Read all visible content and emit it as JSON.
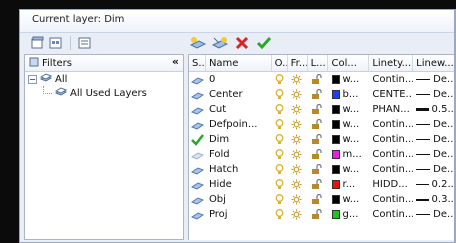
{
  "header": {
    "current_layer": "Current layer: Dim"
  },
  "filters": {
    "title": "Filters",
    "collapse_glyph": "«",
    "tree": [
      {
        "label": "All"
      },
      {
        "label": "All Used Layers"
      }
    ]
  },
  "grid": {
    "columns": [
      "S..",
      "Name",
      "O..",
      "Fr...",
      "L...",
      "Col...",
      "Linety...",
      "Linew..."
    ],
    "rows": [
      {
        "status": "sheet",
        "name": "0",
        "color_hex": "#000000",
        "color": "w...",
        "linetype": "Contin...",
        "lineweight": "De...",
        "lw_style": "thin"
      },
      {
        "status": "sheet",
        "name": "Center",
        "color_hex": "#1d3cff",
        "color": "b...",
        "linetype": "CENTE...",
        "lineweight": "De...",
        "lw_style": "thin"
      },
      {
        "status": "sheet",
        "name": "Cut",
        "color_hex": "#000000",
        "color": "w...",
        "linetype": "PHAN...",
        "lineweight": "0.5...",
        "lw_style": "thick"
      },
      {
        "status": "sheet",
        "name": "Defpoin...",
        "color_hex": "#000000",
        "color": "w...",
        "linetype": "Contin...",
        "lineweight": "De...",
        "lw_style": "thin"
      },
      {
        "status": "current",
        "name": "Dim",
        "color_hex": "#000000",
        "color": "w...",
        "linetype": "Contin...",
        "lineweight": "De...",
        "lw_style": "thin"
      },
      {
        "status": "sheet-faded",
        "name": "Fold",
        "color_hex": "#e61ee6",
        "color": "m...",
        "linetype": "Contin...",
        "lineweight": "De...",
        "lw_style": "thin"
      },
      {
        "status": "sheet",
        "name": "Hatch",
        "color_hex": "#000000",
        "color": "w...",
        "linetype": "Contin...",
        "lineweight": "De...",
        "lw_style": "thin"
      },
      {
        "status": "sheet",
        "name": "Hide",
        "color_hex": "#e81010",
        "color": "r...",
        "linetype": "HIDD...",
        "lineweight": "0.2...",
        "lw_style": "thin"
      },
      {
        "status": "sheet",
        "name": "Obj",
        "color_hex": "#000000",
        "color": "w...",
        "linetype": "Contin...",
        "lineweight": "0.3...",
        "lw_style": "medium"
      },
      {
        "status": "sheet",
        "name": "Proj",
        "color_hex": "#22c222",
        "color": "g...",
        "linetype": "Contin...",
        "lineweight": "De...",
        "lw_style": "thin"
      }
    ]
  },
  "colors": {
    "bulb_on": "#d7b531",
    "sun": "#c89a2a",
    "lock": "#b58b2a",
    "check": "#2ea32e",
    "delete": "#d62525"
  }
}
